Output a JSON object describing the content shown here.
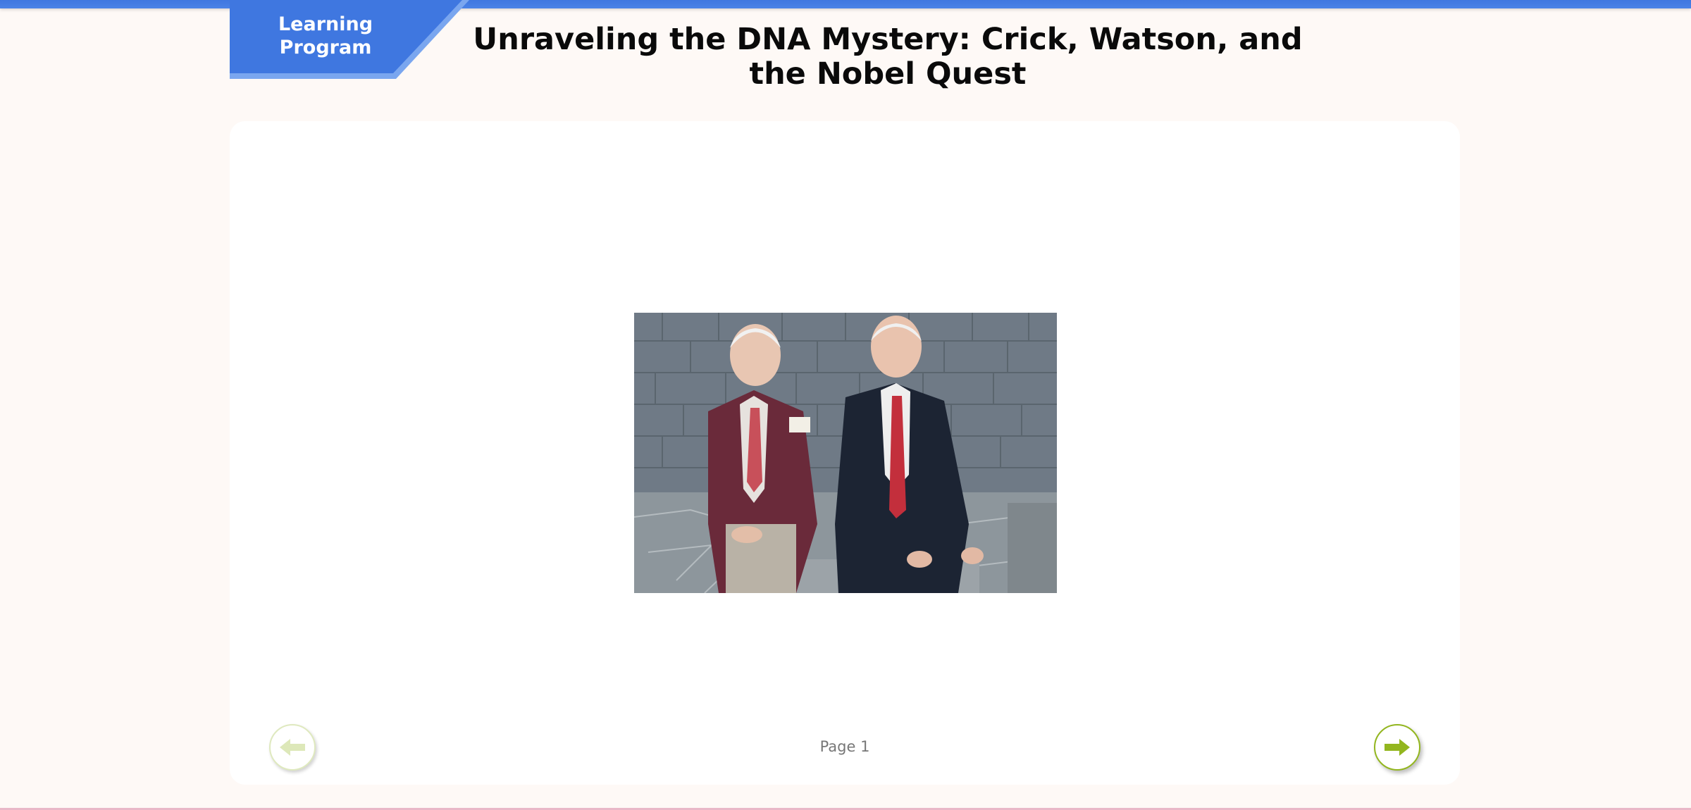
{
  "header": {
    "badge_line1": "Learning",
    "badge_line2": "Program",
    "title": "Unraveling the DNA Mystery: Crick, Watson, and the Nobel Quest"
  },
  "content": {
    "image_subject": "two elderly men in suits seated on a stone ledge in front of a stone wall",
    "page_label": "Page 1"
  },
  "navigation": {
    "prev_icon": "arrow-left-icon",
    "next_icon": "arrow-right-icon"
  },
  "colors": {
    "accent_blue": "#3f77e0",
    "nav_green": "#93b61f",
    "nav_green_disabled": "#dfe9bf",
    "background": "#fef9f6"
  }
}
